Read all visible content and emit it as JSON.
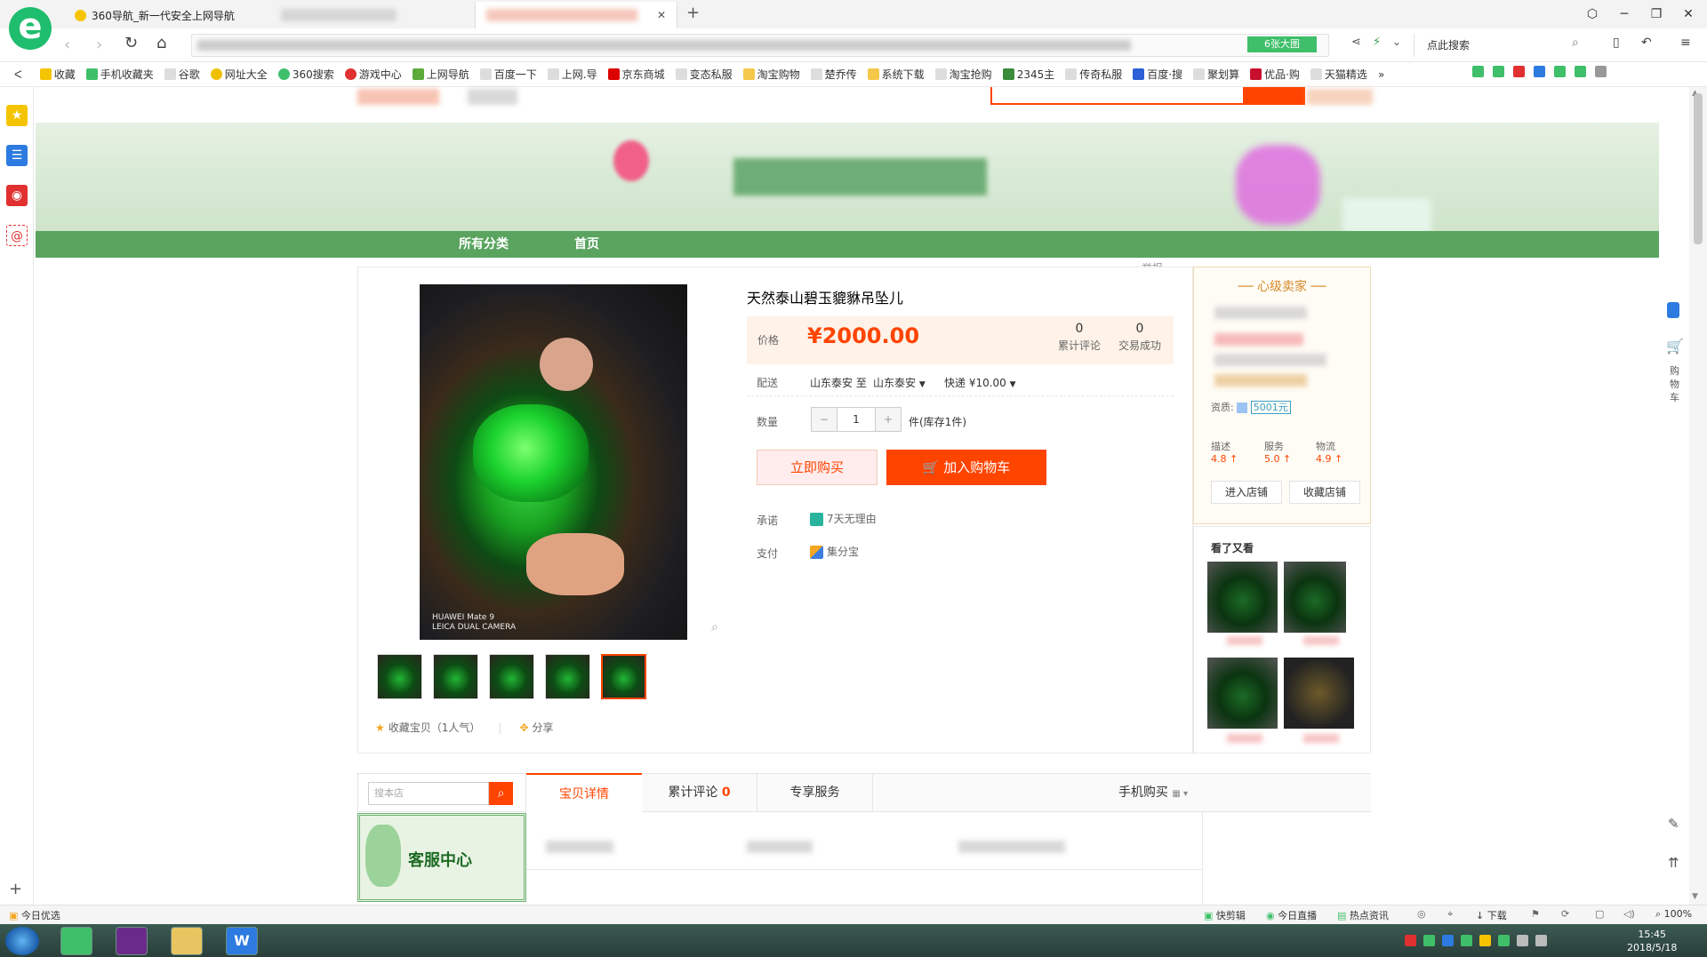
{
  "browser": {
    "logo_letter": "e",
    "tabs": [
      {
        "label": "360导航_新一代安全上网导航",
        "active": false
      },
      {
        "label": "",
        "active": false
      },
      {
        "label": "",
        "active": true
      }
    ],
    "image_button": "6张大图",
    "search_placeholder": "点此搜索",
    "bookmarks": [
      "收藏",
      "手机收藏夹",
      "谷歌",
      "网址大全",
      "360搜索",
      "游戏中心",
      "上网导航",
      "百度一下",
      "上网.导",
      "京东商城",
      "变态私服",
      "淘宝购物",
      "楚乔传",
      "系统下载",
      "淘宝抢购",
      "2345主",
      "传奇私服",
      "百度·搜",
      "聚划算",
      "优品·购",
      "天猫精选"
    ],
    "more_label": "»"
  },
  "shop": {
    "nav": [
      "所有分类",
      "首页"
    ],
    "report": "举报"
  },
  "product": {
    "title": "天然泰山碧玉貔貅吊坠儿",
    "price_label": "价格",
    "price": "¥2000.00",
    "stats": [
      {
        "count": "0",
        "label": "累计评论"
      },
      {
        "count": "0",
        "label": "交易成功"
      }
    ],
    "delivery_label": "配送",
    "delivery_from": "山东泰安 至",
    "delivery_to": "山东泰安",
    "shipping": "快递 ¥10.00",
    "qty_label": "数量",
    "qty_minus": "−",
    "qty": "1",
    "qty_plus": "+",
    "stock": "件(库存1件)",
    "buy_now": "立即购买",
    "add_cart": "加入购物车",
    "promise_label": "承诺",
    "promise": "7天无理由",
    "pay_label": "支付",
    "pay": "集分宝",
    "watermark_l1": "HUAWEI Mate 9",
    "watermark_l2": "LEICA DUAL CAMERA",
    "favorite": "收藏宝贝（1人气）",
    "share": "分享"
  },
  "seller": {
    "title": "心级卖家",
    "qual_label": "资质:",
    "deposit": "5001元",
    "scores": [
      {
        "label": "描述",
        "value": "4.8"
      },
      {
        "label": "服务",
        "value": "5.0"
      },
      {
        "label": "物流",
        "value": "4.9"
      }
    ],
    "enter_shop": "进入店铺",
    "fav_shop": "收藏店铺",
    "also_viewed": "看了又看"
  },
  "bottom": {
    "search_placeholder": "搜本店",
    "customer_service": "客服中心",
    "tabs": [
      "宝贝详情",
      "累计评论",
      "专享服务"
    ],
    "review_count": "0",
    "mobile_buy": "手机购买"
  },
  "right_sidebar": {
    "cart_label": "购物车"
  },
  "statusbar": {
    "left": "今日优选",
    "items": [
      "快剪辑",
      "今日直播",
      "热点资讯",
      "下载"
    ],
    "zoom": "100%"
  },
  "taskbar": {
    "time": "15:45",
    "date": "2018/5/18"
  },
  "colors": {
    "accent": "#ff4400",
    "shop_green": "#5aa45f",
    "browser_green": "#1fbd6e"
  }
}
